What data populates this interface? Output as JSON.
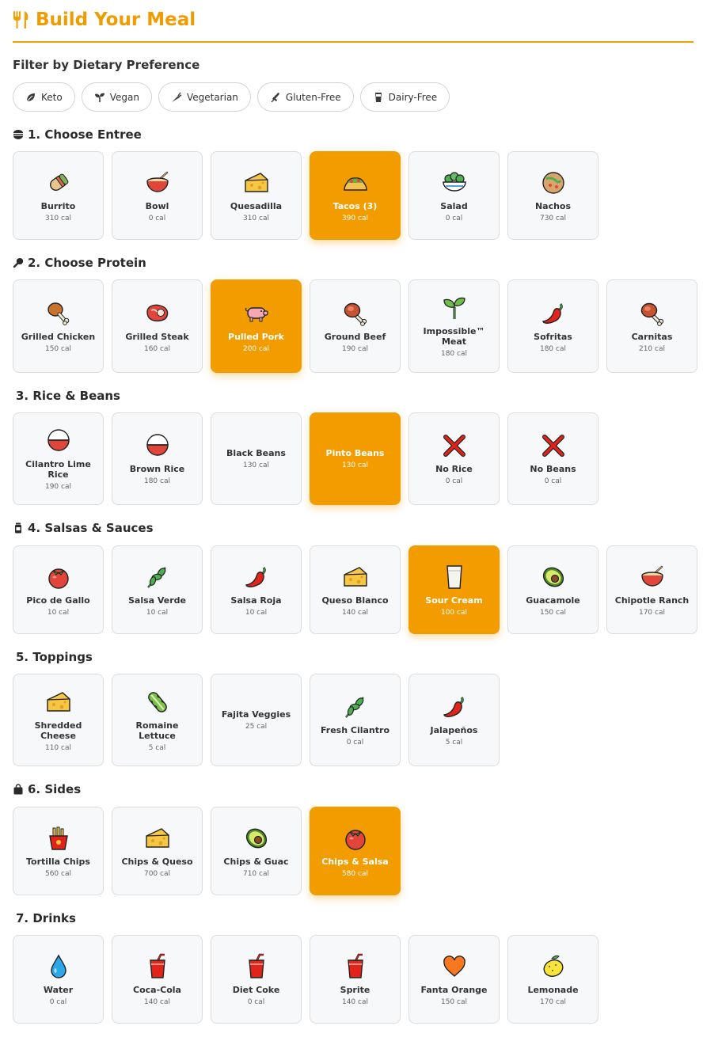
{
  "header": {
    "title": "Build Your Meal"
  },
  "filters": {
    "title": "Filter by Dietary Preference",
    "chips": [
      {
        "label": "Keto",
        "icon": "leaf-icon"
      },
      {
        "label": "Vegan",
        "icon": "sprout-icon"
      },
      {
        "label": "Vegetarian",
        "icon": "carrot-icon"
      },
      {
        "label": "Gluten-Free",
        "icon": "wheat-icon"
      },
      {
        "label": "Dairy-Free",
        "icon": "glass-icon"
      }
    ]
  },
  "sections": [
    {
      "title": "1. Choose Entree",
      "icon": "bowl-icon",
      "items": [
        {
          "name": "Burrito",
          "cal": "310 cal",
          "icon": "burrito-icon",
          "selected": false
        },
        {
          "name": "Bowl",
          "cal": "0 cal",
          "icon": "bowl-icon",
          "selected": false
        },
        {
          "name": "Quesadilla",
          "cal": "310 cal",
          "icon": "cheese-icon",
          "selected": false
        },
        {
          "name": "Tacos (3)",
          "cal": "390 cal",
          "icon": "taco-icon",
          "selected": true
        },
        {
          "name": "Salad",
          "cal": "0 cal",
          "icon": "salad-icon",
          "selected": false
        },
        {
          "name": "Nachos",
          "cal": "730 cal",
          "icon": "flatbread-icon",
          "selected": false
        }
      ]
    },
    {
      "title": "2. Choose Protein",
      "icon": "drumstick-icon",
      "items": [
        {
          "name": "Grilled Chicken",
          "cal": "150 cal",
          "icon": "drumstick-icon",
          "selected": false
        },
        {
          "name": "Grilled Steak",
          "cal": "160 cal",
          "icon": "steak-icon",
          "selected": false
        },
        {
          "name": "Pulled Pork",
          "cal": "200 cal",
          "icon": "pig-icon",
          "selected": true
        },
        {
          "name": "Ground Beef",
          "cal": "190 cal",
          "icon": "meat-bone-icon",
          "selected": false
        },
        {
          "name": "Impossible™ Meat",
          "cal": "180 cal",
          "icon": "seedling-icon",
          "selected": false
        },
        {
          "name": "Sofritas",
          "cal": "180 cal",
          "icon": "pepper-icon",
          "selected": false
        },
        {
          "name": "Carnitas",
          "cal": "210 cal",
          "icon": "meat-bone-icon",
          "selected": false
        }
      ]
    },
    {
      "title": "3. Rice & Beans",
      "icon": "",
      "items": [
        {
          "name": "Cilantro Lime Rice",
          "cal": "190 cal",
          "icon": "rice-bowl-icon",
          "selected": false
        },
        {
          "name": "Brown Rice",
          "cal": "180 cal",
          "icon": "rice-bowl-icon",
          "selected": false
        },
        {
          "name": "Black Beans",
          "cal": "130 cal",
          "icon": "",
          "selected": false
        },
        {
          "name": "Pinto Beans",
          "cal": "130 cal",
          "icon": "",
          "selected": true
        },
        {
          "name": "No Rice",
          "cal": "0 cal",
          "icon": "cross-icon",
          "selected": false
        },
        {
          "name": "No Beans",
          "cal": "0 cal",
          "icon": "cross-icon",
          "selected": false
        }
      ]
    },
    {
      "title": "4. Salsas & Sauces",
      "icon": "jar-icon",
      "items": [
        {
          "name": "Pico de Gallo",
          "cal": "10 cal",
          "icon": "tomato-icon",
          "selected": false
        },
        {
          "name": "Salsa Verde",
          "cal": "10 cal",
          "icon": "herb-icon",
          "selected": false
        },
        {
          "name": "Salsa Roja",
          "cal": "10 cal",
          "icon": "pepper-icon",
          "selected": false
        },
        {
          "name": "Queso Blanco",
          "cal": "140 cal",
          "icon": "cheese-icon",
          "selected": false
        },
        {
          "name": "Sour Cream",
          "cal": "100 cal",
          "icon": "milk-glass-icon",
          "selected": true
        },
        {
          "name": "Guacamole",
          "cal": "150 cal",
          "icon": "avocado-icon",
          "selected": false
        },
        {
          "name": "Chipotle Ranch",
          "cal": "170 cal",
          "icon": "bowl-icon",
          "selected": false
        }
      ]
    },
    {
      "title": "5. Toppings",
      "icon": "",
      "items": [
        {
          "name": "Shredded Cheese",
          "cal": "110 cal",
          "icon": "cheese-icon",
          "selected": false
        },
        {
          "name": "Romaine Lettuce",
          "cal": "5 cal",
          "icon": "lettuce-icon",
          "selected": false
        },
        {
          "name": "Fajita Veggies",
          "cal": "25 cal",
          "icon": "",
          "selected": false
        },
        {
          "name": "Fresh Cilantro",
          "cal": "0 cal",
          "icon": "herb-icon",
          "selected": false
        },
        {
          "name": "Jalapeños",
          "cal": "5 cal",
          "icon": "pepper-icon",
          "selected": false
        }
      ]
    },
    {
      "title": "6. Sides",
      "icon": "bag-icon",
      "items": [
        {
          "name": "Tortilla Chips",
          "cal": "560 cal",
          "icon": "fries-icon",
          "selected": false
        },
        {
          "name": "Chips & Queso",
          "cal": "700 cal",
          "icon": "cheese-icon",
          "selected": false
        },
        {
          "name": "Chips & Guac",
          "cal": "710 cal",
          "icon": "avocado-icon",
          "selected": false
        },
        {
          "name": "Chips & Salsa",
          "cal": "580 cal",
          "icon": "tomato-icon",
          "selected": true
        }
      ]
    },
    {
      "title": "7. Drinks",
      "icon": "",
      "items": [
        {
          "name": "Water",
          "cal": "0 cal",
          "icon": "droplet-icon",
          "selected": false
        },
        {
          "name": "Coca-Cola",
          "cal": "140 cal",
          "icon": "cup-straw-icon",
          "selected": false
        },
        {
          "name": "Diet Coke",
          "cal": "0 cal",
          "icon": "cup-straw-icon",
          "selected": false
        },
        {
          "name": "Sprite",
          "cal": "140 cal",
          "icon": "cup-straw-icon",
          "selected": false
        },
        {
          "name": "Fanta Orange",
          "cal": "150 cal",
          "icon": "heart-icon",
          "selected": false
        },
        {
          "name": "Lemonade",
          "cal": "170 cal",
          "icon": "lemon-icon",
          "selected": false
        }
      ]
    }
  ],
  "colors": {
    "accent": "#f29c00",
    "card_bg": "#f7f8fa",
    "border": "#dcdcdc"
  }
}
